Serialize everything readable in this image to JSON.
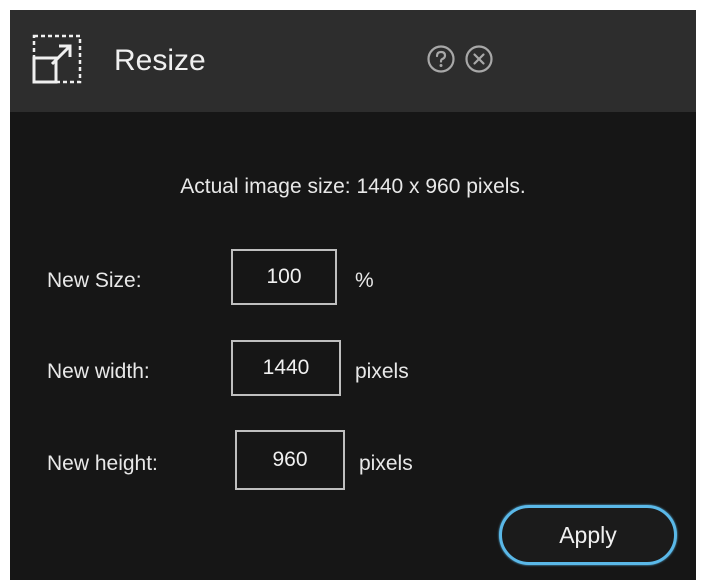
{
  "dialog": {
    "title": "Resize",
    "icons": {
      "title": "resize-icon",
      "help": "help-icon",
      "close": "close-icon"
    }
  },
  "info": {
    "text": "Actual image size: 1440 x 960 pixels."
  },
  "form": {
    "size": {
      "label": "New Size:",
      "value": "100",
      "unit": "%"
    },
    "width": {
      "label": "New width:",
      "value": "1440",
      "unit": "pixels"
    },
    "height": {
      "label": "New height:",
      "value": "960",
      "unit": "pixels"
    }
  },
  "actions": {
    "apply_label": "Apply"
  },
  "colors": {
    "background": "#161616",
    "titlebar": "#2d2d2d",
    "accent": "#5ab8e8",
    "field_border": "#bfbfbf"
  }
}
